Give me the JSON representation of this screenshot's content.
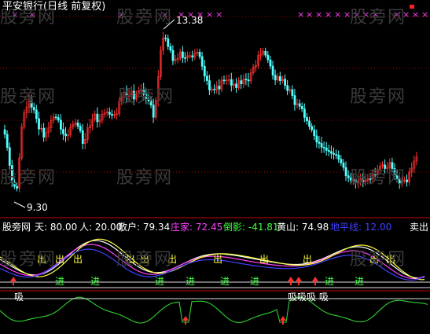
{
  "header": {
    "title": "平安银行(日线 前复权)",
    "title_color": "#ffffff"
  },
  "watermark": {
    "text": "股旁网",
    "color": "#3a3a3a"
  },
  "price_panel": {
    "high_label": "13.38",
    "low_label": "9.30",
    "up_color": "#ff3030",
    "down_color": "#54ffff",
    "marker_color": "#ff40ff",
    "marker_glyph": "×",
    "gridline_color": "#b00000"
  },
  "indicator_bar": {
    "name": "股旁网",
    "items": [
      {
        "label": "天: 80.00",
        "color": "#ffffff"
      },
      {
        "label": "人: 20.00",
        "color": "#ffffff"
      },
      {
        "label": "散户: 79.34",
        "color": "#ffffff"
      },
      {
        "label": "庄家: 72.45",
        "color": "#ff40ff"
      },
      {
        "label": "倒影: -41.81",
        "color": "#40ff40"
      },
      {
        "label": "黄山: 74.98",
        "color": "#ffffff"
      },
      {
        "label": "地平线: 12.00",
        "color": "#4040ff"
      }
    ],
    "sell_label": "卖出"
  },
  "signals": {
    "out_label": "出",
    "in_label": "进",
    "out_color": "#ffff40",
    "in_color": "#40ff40"
  },
  "bottom_panel": {
    "left_label": "吸",
    "mid_label": "吸吸吸 吸",
    "line_color": "#30d030"
  },
  "chart_data": {
    "type": "candlestick",
    "price_high": 13.38,
    "price_low": 9.3
  }
}
